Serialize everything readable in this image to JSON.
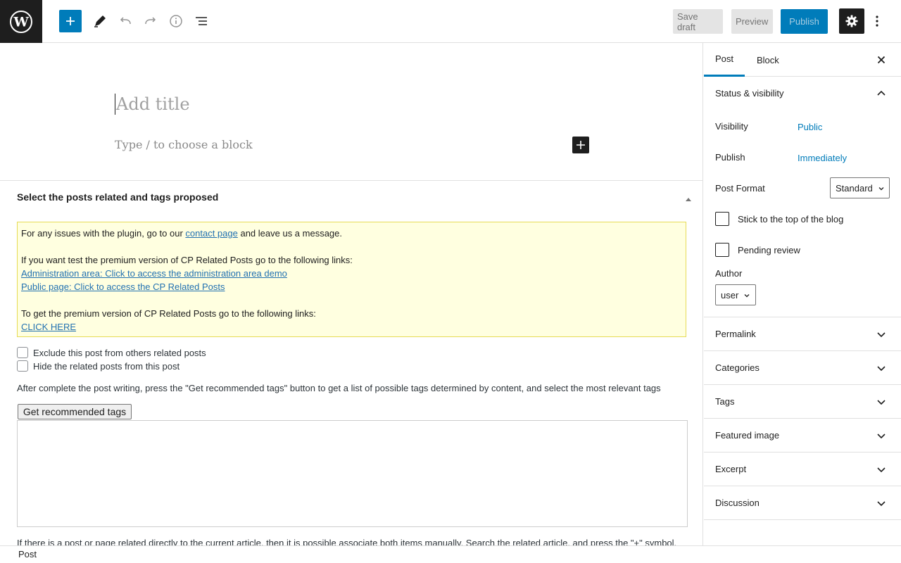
{
  "toolbar": {
    "save_draft_label": "Save draft",
    "preview_label": "Preview",
    "publish_label": "Publish"
  },
  "editor": {
    "title_placeholder": "Add title",
    "block_placeholder": "Type / to choose a block"
  },
  "metabox": {
    "title": "Select the posts related and tags proposed",
    "notice": {
      "line1_prefix": "For any issues with the plugin, go to our ",
      "line1_link": "contact page",
      "line1_suffix": " and leave us a message.",
      "line2": "If you want test the premium version of CP Related Posts go to the following links:",
      "admin_link": "Administration area: Click to access the administration area demo",
      "public_link": "Public page: Click to access the CP Related Posts",
      "line3": "To get the premium version of CP Related Posts go to the following links:",
      "click_here": "CLICK HERE"
    },
    "exclude_label": "Exclude this post from others related posts",
    "hide_label": "Hide the related posts from this post",
    "description": "After complete the post writing, press the \"Get recommended tags\" button to get a list of possible tags determined by content, and select the most relevant tags",
    "recommended_button": "Get recommended tags",
    "manual_description": "If there is a post or page related directly to the current article, then it is possible associate both items manually. Search the related article, and press the \"+\" symbol."
  },
  "footer": {
    "breadcrumb": "Post"
  },
  "sidebar": {
    "tab_post": "Post",
    "tab_block": "Block",
    "status_title": "Status & visibility",
    "visibility_label": "Visibility",
    "visibility_value": "Public",
    "publish_label": "Publish",
    "publish_value": "Immediately",
    "post_format_label": "Post Format",
    "post_format_value": "Standard",
    "sticky_label": "Stick to the top of the blog",
    "pending_label": "Pending review",
    "author_label": "Author",
    "author_value": "user",
    "panels": [
      "Permalink",
      "Categories",
      "Tags",
      "Featured image",
      "Excerpt",
      "Discussion"
    ]
  }
}
